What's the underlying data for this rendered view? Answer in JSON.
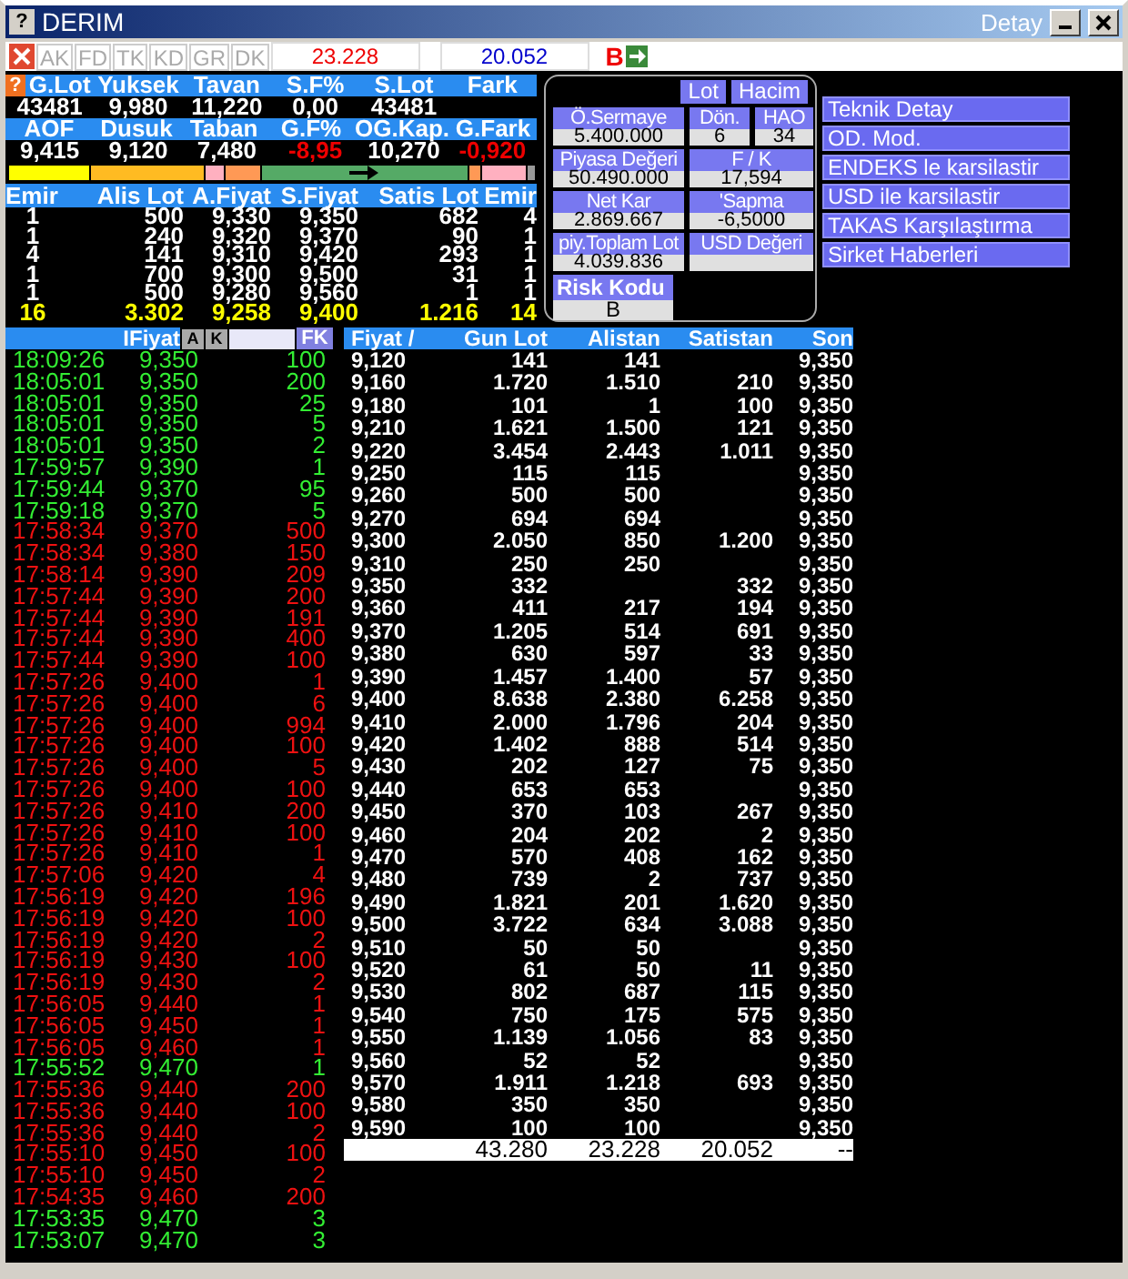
{
  "window": {
    "help": "?",
    "title": "DERIM",
    "subtitle": "Detay"
  },
  "summary_help": "?",
  "toolbar": {
    "tabs": [
      {
        "label": "AK",
        "disabled": true
      },
      {
        "label": "FD",
        "disabled": true
      },
      {
        "label": "TK",
        "disabled": true
      },
      {
        "label": "KD",
        "disabled": true
      },
      {
        "label": "GR",
        "disabled": true
      },
      {
        "label": "DK",
        "disabled": true
      }
    ],
    "buy_total": "23.228",
    "sell_total": "20.052",
    "side": "B"
  },
  "summary": [
    {
      "headers": [
        "G.Lot",
        "Yuksek",
        "Tavan",
        "S.F%",
        "S.Lot",
        "Fark"
      ],
      "values": [
        {
          "text": "43481",
          "negative": false
        },
        {
          "text": "9,980",
          "negative": false
        },
        {
          "text": "11,220",
          "negative": false
        },
        {
          "text": "0,00",
          "negative": false
        },
        {
          "text": "43481",
          "negative": false
        }
      ]
    },
    {
      "headers": [
        "AOF",
        "Dusuk",
        "Taban",
        "G.F%",
        "OG.Kap.",
        "G.Fark"
      ],
      "values": [
        {
          "text": "9,415",
          "negative": false
        },
        {
          "text": "9,120",
          "negative": false
        },
        {
          "text": "7,480",
          "negative": false
        },
        {
          "text": "-8,95",
          "negative": true
        },
        {
          "text": "10,270",
          "negative": false
        },
        {
          "text": "-0,920",
          "negative": true
        }
      ]
    }
  ],
  "range_bar": [
    {
      "color": "#ffff00"
    },
    {
      "color": "#ffbb22"
    },
    {
      "color": "#ffb0c0"
    },
    {
      "color": "#ff9955"
    },
    {
      "color": "#55aa66",
      "marker": true
    },
    {
      "color": "#ff9955"
    },
    {
      "color": "#ffb0c0"
    },
    {
      "color": "#999999"
    }
  ],
  "depth": {
    "columns": [
      "Emir",
      "Alis Lot",
      "A.Fiyat",
      "S.Fiyat",
      "Satis Lot",
      "Emir"
    ],
    "rows": [
      [
        "1",
        "500",
        "9,330",
        "9,350",
        "682",
        "4"
      ],
      [
        "1",
        "240",
        "9,320",
        "9,370",
        "90",
        "1"
      ],
      [
        "4",
        "141",
        "9,310",
        "9,420",
        "293",
        "1"
      ],
      [
        "1",
        "700",
        "9,300",
        "9,500",
        "31",
        "1"
      ],
      [
        "1",
        "500",
        "9,280",
        "9,560",
        "1",
        "1"
      ]
    ],
    "total": [
      "16",
      "3.302",
      "9,258",
      "9,400",
      "1.216",
      "14"
    ]
  },
  "detail": {
    "toggles": [
      "Lot",
      "Hacim"
    ],
    "fields": [
      {
        "label": "Ö.Sermaye",
        "value": "5.400.000"
      },
      {
        "label": "Dön.",
        "value": "6"
      },
      {
        "label": "HAO",
        "value": "34"
      },
      {
        "label": "Piyasa Değeri",
        "value": "50.490.000"
      },
      {
        "label": "F / K",
        "value": "17,594"
      },
      {
        "label": "Net Kar",
        "value": "2.869.667"
      },
      {
        "label": "'Sapma",
        "value": "-6,5000"
      },
      {
        "label": "piy.Toplam Lot",
        "value": "4.039.836"
      },
      {
        "label": "USD Değeri"
      }
    ],
    "risk": {
      "label": "Risk Kodu",
      "value": "B"
    }
  },
  "menu": [
    "Teknik Detay",
    "OD. Mod.",
    "ENDEKS le karsilastir",
    "USD ile karsilastir",
    "TAKAS Karşılaştırma",
    "Sirket Haberleri"
  ],
  "trades": {
    "price_header": "IFiyat",
    "buttons": [
      "A",
      "K"
    ],
    "filter_button": "FK",
    "rows": [
      {
        "time": "18:09:26",
        "price": "9,350",
        "lot": "100",
        "color": "#33ee33"
      },
      {
        "time": "18:05:01",
        "price": "9,350",
        "lot": "200",
        "color": "#33ee33"
      },
      {
        "time": "18:05:01",
        "price": "9,350",
        "lot": "25",
        "color": "#33ee33"
      },
      {
        "time": "18:05:01",
        "price": "9,350",
        "lot": "5",
        "color": "#33ee33"
      },
      {
        "time": "18:05:01",
        "price": "9,350",
        "lot": "2",
        "color": "#33ee33"
      },
      {
        "time": "17:59:57",
        "price": "9,390",
        "lot": "1",
        "color": "#33ee33"
      },
      {
        "time": "17:59:44",
        "price": "9,370",
        "lot": "95",
        "color": "#33ee33"
      },
      {
        "time": "17:59:18",
        "price": "9,370",
        "lot": "5",
        "color": "#33ee33"
      },
      {
        "time": "17:58:34",
        "price": "9,370",
        "lot": "500",
        "color": "#ee1111"
      },
      {
        "time": "17:58:34",
        "price": "9,380",
        "lot": "150",
        "color": "#ee1111"
      },
      {
        "time": "17:58:14",
        "price": "9,390",
        "lot": "209",
        "color": "#ee1111"
      },
      {
        "time": "17:57:44",
        "price": "9,390",
        "lot": "200",
        "color": "#ee1111"
      },
      {
        "time": "17:57:44",
        "price": "9,390",
        "lot": "191",
        "color": "#ee1111"
      },
      {
        "time": "17:57:44",
        "price": "9,390",
        "lot": "400",
        "color": "#ee1111"
      },
      {
        "time": "17:57:44",
        "price": "9,390",
        "lot": "100",
        "color": "#ee1111"
      },
      {
        "time": "17:57:26",
        "price": "9,400",
        "lot": "1",
        "color": "#ee1111"
      },
      {
        "time": "17:57:26",
        "price": "9,400",
        "lot": "6",
        "color": "#ee1111"
      },
      {
        "time": "17:57:26",
        "price": "9,400",
        "lot": "994",
        "color": "#ee1111"
      },
      {
        "time": "17:57:26",
        "price": "9,400",
        "lot": "100",
        "color": "#ee1111"
      },
      {
        "time": "17:57:26",
        "price": "9,400",
        "lot": "5",
        "color": "#ee1111"
      },
      {
        "time": "17:57:26",
        "price": "9,400",
        "lot": "100",
        "color": "#ee1111"
      },
      {
        "time": "17:57:26",
        "price": "9,410",
        "lot": "200",
        "color": "#ee1111"
      },
      {
        "time": "17:57:26",
        "price": "9,410",
        "lot": "100",
        "color": "#ee1111"
      },
      {
        "time": "17:57:26",
        "price": "9,410",
        "lot": "1",
        "color": "#ee1111"
      },
      {
        "time": "17:57:06",
        "price": "9,420",
        "lot": "4",
        "color": "#ee1111"
      },
      {
        "time": "17:56:19",
        "price": "9,420",
        "lot": "196",
        "color": "#ee1111"
      },
      {
        "time": "17:56:19",
        "price": "9,420",
        "lot": "100",
        "color": "#ee1111"
      },
      {
        "time": "17:56:19",
        "price": "9,420",
        "lot": "2",
        "color": "#ee1111"
      },
      {
        "time": "17:56:19",
        "price": "9,430",
        "lot": "100",
        "color": "#ee1111"
      },
      {
        "time": "17:56:19",
        "price": "9,430",
        "lot": "2",
        "color": "#ee1111"
      },
      {
        "time": "17:56:05",
        "price": "9,440",
        "lot": "1",
        "color": "#ee1111"
      },
      {
        "time": "17:56:05",
        "price": "9,450",
        "lot": "1",
        "color": "#ee1111"
      },
      {
        "time": "17:56:05",
        "price": "9,460",
        "lot": "1",
        "color": "#ee1111"
      },
      {
        "time": "17:55:52",
        "price": "9,470",
        "lot": "1",
        "color": "#33ee33"
      },
      {
        "time": "17:55:36",
        "price": "9,440",
        "lot": "200",
        "color": "#ee1111"
      },
      {
        "time": "17:55:36",
        "price": "9,440",
        "lot": "100",
        "color": "#ee1111"
      },
      {
        "time": "17:55:36",
        "price": "9,440",
        "lot": "2",
        "color": "#ee1111"
      },
      {
        "time": "17:55:10",
        "price": "9,450",
        "lot": "100",
        "color": "#ee1111"
      },
      {
        "time": "17:55:10",
        "price": "9,450",
        "lot": "2",
        "color": "#ee1111"
      },
      {
        "time": "17:54:35",
        "price": "9,460",
        "lot": "200",
        "color": "#ee1111"
      },
      {
        "time": "17:53:35",
        "price": "9,470",
        "lot": "3",
        "color": "#33ee33"
      },
      {
        "time": "17:53:07",
        "price": "9,470",
        "lot": "3",
        "color": "#33ee33"
      }
    ]
  },
  "price_table": {
    "columns": [
      "Fiyat /",
      "Gun Lot",
      "Alistan",
      "Satistan",
      "Son"
    ],
    "rows": [
      {
        "fiyat": "9,120",
        "gun_lot": "141",
        "alistan": "141",
        "son": "9,350"
      },
      {
        "fiyat": "9,160",
        "gun_lot": "1.720",
        "alistan": "1.510",
        "satistan": "210",
        "son": "9,350"
      },
      {
        "fiyat": "9,180",
        "gun_lot": "101",
        "alistan": "1",
        "satistan": "100",
        "son": "9,350"
      },
      {
        "fiyat": "9,210",
        "gun_lot": "1.621",
        "alistan": "1.500",
        "satistan": "121",
        "son": "9,350"
      },
      {
        "fiyat": "9,220",
        "gun_lot": "3.454",
        "alistan": "2.443",
        "satistan": "1.011",
        "son": "9,350"
      },
      {
        "fiyat": "9,250",
        "gun_lot": "115",
        "alistan": "115",
        "son": "9,350"
      },
      {
        "fiyat": "9,260",
        "gun_lot": "500",
        "alistan": "500",
        "son": "9,350"
      },
      {
        "fiyat": "9,270",
        "gun_lot": "694",
        "alistan": "694",
        "son": "9,350"
      },
      {
        "fiyat": "9,300",
        "gun_lot": "2.050",
        "alistan": "850",
        "satistan": "1.200",
        "son": "9,350"
      },
      {
        "fiyat": "9,310",
        "gun_lot": "250",
        "alistan": "250",
        "son": "9,350"
      },
      {
        "fiyat": "9,350",
        "gun_lot": "332",
        "satistan": "332",
        "son": "9,350"
      },
      {
        "fiyat": "9,360",
        "gun_lot": "411",
        "alistan": "217",
        "satistan": "194",
        "son": "9,350"
      },
      {
        "fiyat": "9,370",
        "gun_lot": "1.205",
        "alistan": "514",
        "satistan": "691",
        "son": "9,350"
      },
      {
        "fiyat": "9,380",
        "gun_lot": "630",
        "alistan": "597",
        "satistan": "33",
        "son": "9,350"
      },
      {
        "fiyat": "9,390",
        "gun_lot": "1.457",
        "alistan": "1.400",
        "satistan": "57",
        "son": "9,350"
      },
      {
        "fiyat": "9,400",
        "gun_lot": "8.638",
        "alistan": "2.380",
        "satistan": "6.258",
        "son": "9,350"
      },
      {
        "fiyat": "9,410",
        "gun_lot": "2.000",
        "alistan": "1.796",
        "satistan": "204",
        "son": "9,350"
      },
      {
        "fiyat": "9,420",
        "gun_lot": "1.402",
        "alistan": "888",
        "satistan": "514",
        "son": "9,350"
      },
      {
        "fiyat": "9,430",
        "gun_lot": "202",
        "alistan": "127",
        "satistan": "75",
        "son": "9,350"
      },
      {
        "fiyat": "9,440",
        "gun_lot": "653",
        "alistan": "653",
        "son": "9,350"
      },
      {
        "fiyat": "9,450",
        "gun_lot": "370",
        "alistan": "103",
        "satistan": "267",
        "son": "9,350"
      },
      {
        "fiyat": "9,460",
        "gun_lot": "204",
        "alistan": "202",
        "satistan": "2",
        "son": "9,350"
      },
      {
        "fiyat": "9,470",
        "gun_lot": "570",
        "alistan": "408",
        "satistan": "162",
        "son": "9,350"
      },
      {
        "fiyat": "9,480",
        "gun_lot": "739",
        "alistan": "2",
        "satistan": "737",
        "son": "9,350"
      },
      {
        "fiyat": "9,490",
        "gun_lot": "1.821",
        "alistan": "201",
        "satistan": "1.620",
        "son": "9,350"
      },
      {
        "fiyat": "9,500",
        "gun_lot": "3.722",
        "alistan": "634",
        "satistan": "3.088",
        "son": "9,350"
      },
      {
        "fiyat": "9,510",
        "gun_lot": "50",
        "alistan": "50",
        "son": "9,350"
      },
      {
        "fiyat": "9,520",
        "gun_lot": "61",
        "alistan": "50",
        "satistan": "11",
        "son": "9,350"
      },
      {
        "fiyat": "9,530",
        "gun_lot": "802",
        "alistan": "687",
        "satistan": "115",
        "son": "9,350"
      },
      {
        "fiyat": "9,540",
        "gun_lot": "750",
        "alistan": "175",
        "satistan": "575",
        "son": "9,350"
      },
      {
        "fiyat": "9,550",
        "gun_lot": "1.139",
        "alistan": "1.056",
        "satistan": "83",
        "son": "9,350"
      },
      {
        "fiyat": "9,560",
        "gun_lot": "52",
        "alistan": "52",
        "son": "9,350"
      },
      {
        "fiyat": "9,570",
        "gun_lot": "1.911",
        "alistan": "1.218",
        "satistan": "693",
        "son": "9,350"
      },
      {
        "fiyat": "9,580",
        "gun_lot": "350",
        "alistan": "350",
        "son": "9,350"
      },
      {
        "fiyat": "9,590",
        "gun_lot": "100",
        "alistan": "100",
        "son": "9,350"
      }
    ],
    "total": {
      "gun_lot": "43.280",
      "alistan": "23.228",
      "satistan": "20.052",
      "son": "--"
    }
  }
}
